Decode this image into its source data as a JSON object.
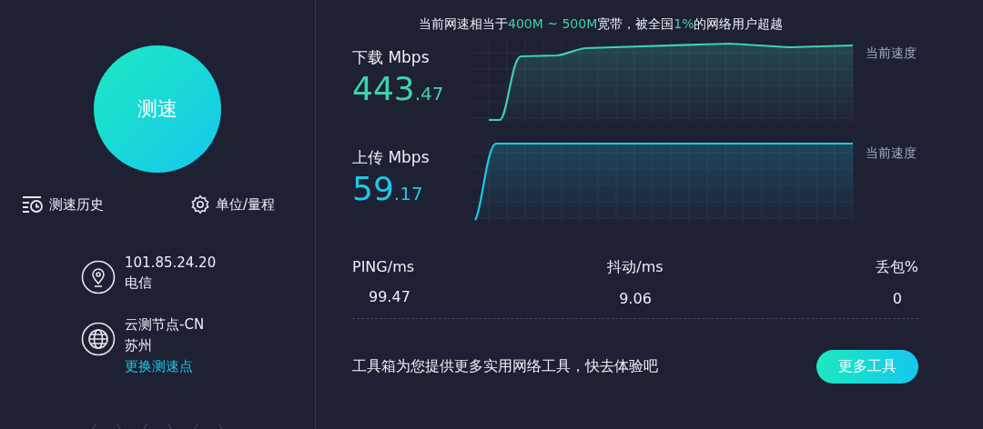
{
  "speed_test_button": "测速",
  "actions": [
    {
      "kind": "history",
      "label": "测速历史"
    },
    {
      "kind": "settings",
      "label": "单位/量程"
    }
  ],
  "info": [
    {
      "kind": "location",
      "lines": [
        "101.85.24.20",
        "电信"
      ]
    },
    {
      "kind": "server",
      "lines": [
        "云测节点-CN",
        "苏州"
      ],
      "link": "更换测速点"
    }
  ],
  "headline": [
    {
      "text": "当前网速相当于",
      "highlight": false
    },
    {
      "text": "400M ~ 500M",
      "highlight": true
    },
    {
      "text": "宽带，被全国",
      "highlight": false
    },
    {
      "text": "1%",
      "highlight": true
    },
    {
      "text": "的网络用户超越",
      "highlight": false
    }
  ],
  "meters": [
    {
      "kind": "download",
      "label": "下载 Mbps",
      "integer": "443",
      "decimal": ".47",
      "current_label": "当前速度"
    },
    {
      "kind": "upload",
      "label": "上传 Mbps",
      "integer": "59",
      "decimal": ".17",
      "current_label": "当前速度"
    }
  ],
  "stats": [
    {
      "label": "PING/ms",
      "value": "99.47"
    },
    {
      "label": "抖动/ms",
      "value": "9.06"
    },
    {
      "label": "丢包%",
      "value": "0"
    }
  ],
  "toolbox": {
    "text": "工具箱为您提供更多实用网络工具，快去体验吧",
    "button": "更多工具"
  }
}
